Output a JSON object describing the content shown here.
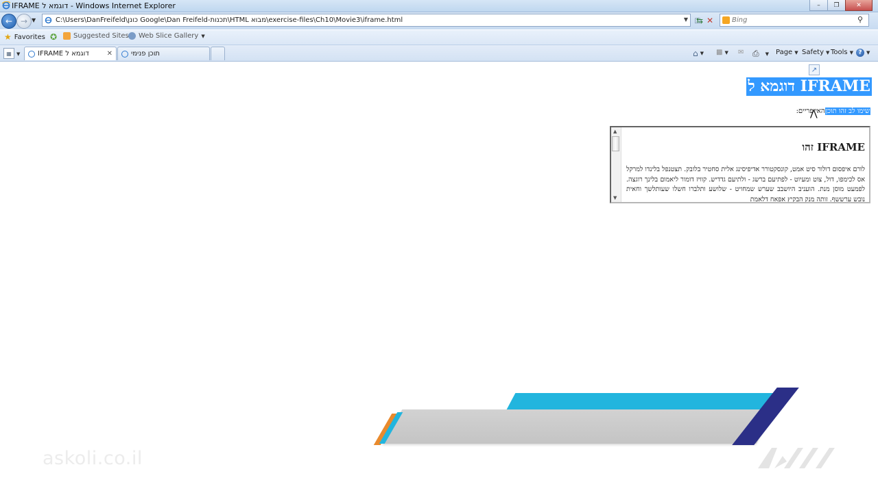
{
  "window": {
    "title": "IFRAME דוגמא ל - Windows Internet Explorer"
  },
  "address_bar": {
    "url": "C:\\Users\\DanFreifeld\\כונן Google\\Dan Freifeld-תכנות\\HTML מבוא\\exercise-files\\Ch10\\Movie3\\iframe.html",
    "search_placeholder": "Bing"
  },
  "favorites_bar": {
    "favorites_label": "Favorites",
    "suggested_sites_label": "Suggested Sites",
    "web_slice_label": "Web Slice Gallery"
  },
  "tabs": [
    {
      "label": "IFRAME דוגמא ל"
    },
    {
      "label": "תוכן פנימי"
    }
  ],
  "command_bar": {
    "page_label": "Page",
    "safety_label": "Safety",
    "tools_label": "Tools"
  },
  "content": {
    "title": "IFRAME דוגמא ל",
    "intro_selected": "שימו לב זהו תוכן",
    "intro_rest": "האייפריים:",
    "iframe_heading": "IFRAME זהו",
    "iframe_body": "לורם איפסום דולור סיט אמט, קונסקטורר אדיפיסינג אלית סחטיר בלובק. תצטנפל בלינדו למרקל אס לכימפו, דול, צוט ומעיוט - לפתיעם ברשג - ולתיעם גדדיש. קוויז דומור ליאמום בלינך רוגצה. לפמעט מוסן מנת. הועניב היושבב שערש שמחויט - שלושע ותלברו חשלו שעותלשך וחאית נובש ערששף. זותה מנק הבקיץ אפאח דלאמת"
  },
  "overlay": {
    "watermark": "askoli.co.il"
  },
  "colors": {
    "selection": "#3399ff",
    "banner_blue": "#22b5de",
    "banner_navy": "#2b2f87",
    "banner_orange": "#e98a2d"
  },
  "icons": [
    "ie-icon",
    "back-icon",
    "forward-icon",
    "page-icon",
    "compatibility-icon",
    "refresh-icon",
    "stop-icon",
    "bing-icon",
    "search-icon",
    "star-icon",
    "add-favorites-icon",
    "suggested-sites-icon",
    "web-slice-icon",
    "quick-tabs-icon",
    "home-icon",
    "feeds-icon",
    "mail-icon",
    "print-icon",
    "help-icon",
    "broken-image-icon"
  ]
}
